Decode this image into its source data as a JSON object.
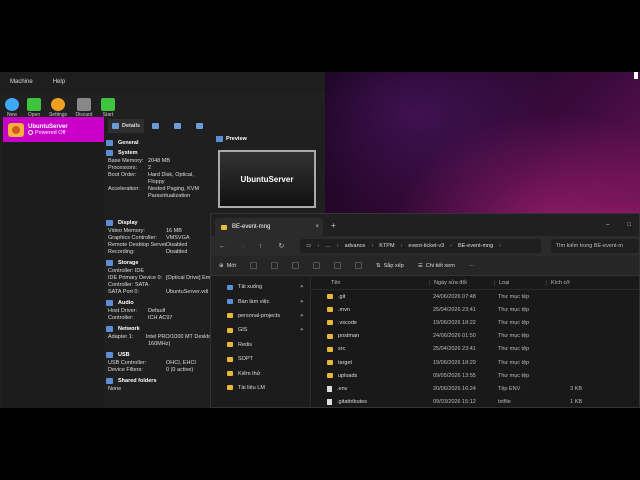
{
  "vbox": {
    "menu": [
      "Machine",
      "Help"
    ],
    "toolbar": [
      {
        "label": "New",
        "icon": "new-star-icon",
        "color": "#3fa9f5"
      },
      {
        "label": "Open",
        "icon": "add-plus-icon",
        "color": "#3fc43f"
      },
      {
        "label": "Settings",
        "icon": "gear-icon",
        "color": "#f0a020"
      },
      {
        "label": "Discard",
        "icon": "discard-arrow-icon",
        "color": "#888888"
      },
      {
        "label": "Start",
        "icon": "start-arrow-icon",
        "color": "#3fc43f"
      }
    ],
    "vm": {
      "name": "UbuntuServer",
      "state": "Powered Off",
      "highlight": "#c800c8"
    },
    "tabs": [
      "Details"
    ],
    "preview_title": "Preview",
    "preview_text": "UbuntuServer",
    "sections": {
      "general": {
        "title": "General"
      },
      "system": {
        "title": "System",
        "rows": [
          {
            "k": "Base Memory:",
            "v": "2048 MB"
          },
          {
            "k": "Processors:",
            "v": "2"
          },
          {
            "k": "Boot Order:",
            "v": "Hard Disk, Optical,"
          },
          {
            "k": "",
            "v": "Floppy"
          },
          {
            "k": "Acceleration:",
            "v": "Nested Paging, KVM"
          },
          {
            "k": "",
            "v": "Paravirtualization"
          }
        ]
      },
      "display": {
        "title": "Display",
        "rows": [
          {
            "k": "Video Memory:",
            "v": "16 MB"
          },
          {
            "k": "Graphics Controller:",
            "v": "VMSVGA"
          },
          {
            "k": "Remote Desktop Server:",
            "v": "Disabled"
          },
          {
            "k": "Recording:",
            "v": "Disabled"
          }
        ]
      },
      "storage": {
        "title": "Storage",
        "rows": [
          {
            "k": "Controller: IDE",
            "v": ""
          },
          {
            "k": "IDE Primary Device 0:",
            "v": "[Optical Drive] Em"
          },
          {
            "k": "Controller: SATA",
            "v": ""
          },
          {
            "k": "SATA Port 0:",
            "v": "UbuntuServer.vdi"
          }
        ]
      },
      "audio": {
        "title": "Audio",
        "rows": [
          {
            "k": "Host Driver:",
            "v": "Default"
          },
          {
            "k": "Controller:",
            "v": "ICH AC97"
          }
        ]
      },
      "network": {
        "title": "Network",
        "rows": [
          {
            "k": "Adapter 1:",
            "v": "Intel PRO/1000 MT Desktop ("
          },
          {
            "k": "",
            "v": "160MHz)"
          }
        ]
      },
      "usb": {
        "title": "USB",
        "rows": [
          {
            "k": "USB Controller:",
            "v": "OHCI, EHCI"
          },
          {
            "k": "Device Filters:",
            "v": "0 (0 active)"
          }
        ]
      },
      "shared": {
        "title": "Shared folders",
        "rows": [
          {
            "k": "None",
            "v": ""
          }
        ]
      }
    }
  },
  "explorer": {
    "tab_title": "BE-event-mng",
    "tab_close": "×",
    "new_tab": "+",
    "win_buttons": [
      "–",
      "□"
    ],
    "breadcrumb": [
      "advance",
      "KTPM",
      "event-ticket-v3",
      "BE-event-mng"
    ],
    "search_placeholder": "Tìm kiếm trong BE-event-m",
    "commands": {
      "new": "Mới",
      "sort": "Sắp xếp",
      "view": "Chi tiết xem"
    },
    "nav": [
      {
        "label": "Tải xuống",
        "pinned": true,
        "special": true
      },
      {
        "label": "Bàn làm việc",
        "pinned": true,
        "special": true
      },
      {
        "label": "personal-projects",
        "pinned": true,
        "special": false
      },
      {
        "label": "GIS",
        "pinned": true,
        "special": false
      },
      {
        "label": "Redis",
        "pinned": false,
        "special": false
      },
      {
        "label": "SOPT",
        "pinned": false,
        "special": false
      },
      {
        "label": "Kiểm thử",
        "pinned": false,
        "special": false
      },
      {
        "label": "Tài liệu LM",
        "pinned": false,
        "special": false
      }
    ],
    "columns": {
      "name": "Tên",
      "date": "Ngày sửa đổi",
      "type": "Loại",
      "size": "Kích cỡ"
    },
    "files": [
      {
        "name": ".git",
        "date": "24/06/2026 07:48",
        "type": "Thư mục tệp",
        "size": "",
        "folder": true
      },
      {
        "name": ".mvn",
        "date": "25/04/2026 23:41",
        "type": "Thư mục tệp",
        "size": "",
        "folder": true
      },
      {
        "name": ".vscode",
        "date": "19/06/2026 18:22",
        "type": "Thư mục tệp",
        "size": "",
        "folder": true
      },
      {
        "name": "postman",
        "date": "24/06/2026 01:50",
        "type": "Thư mục tệp",
        "size": "",
        "folder": true
      },
      {
        "name": "src",
        "date": "25/04/2026 23:41",
        "type": "Thư mục tệp",
        "size": "",
        "folder": true
      },
      {
        "name": "target",
        "date": "19/06/2026 18:29",
        "type": "Thư mục tệp",
        "size": "",
        "folder": true
      },
      {
        "name": "uploads",
        "date": "09/05/2026 13:55",
        "type": "Thư mục tệp",
        "size": "",
        "folder": true
      },
      {
        "name": ".env",
        "date": "20/06/2026 16:24",
        "type": "Tệp ENV",
        "size": "3 KB",
        "folder": false
      },
      {
        "name": ".gitattributes",
        "date": "09/03/2026 15:12",
        "type": "txtfile",
        "size": "1 KB",
        "folder": false
      }
    ]
  }
}
